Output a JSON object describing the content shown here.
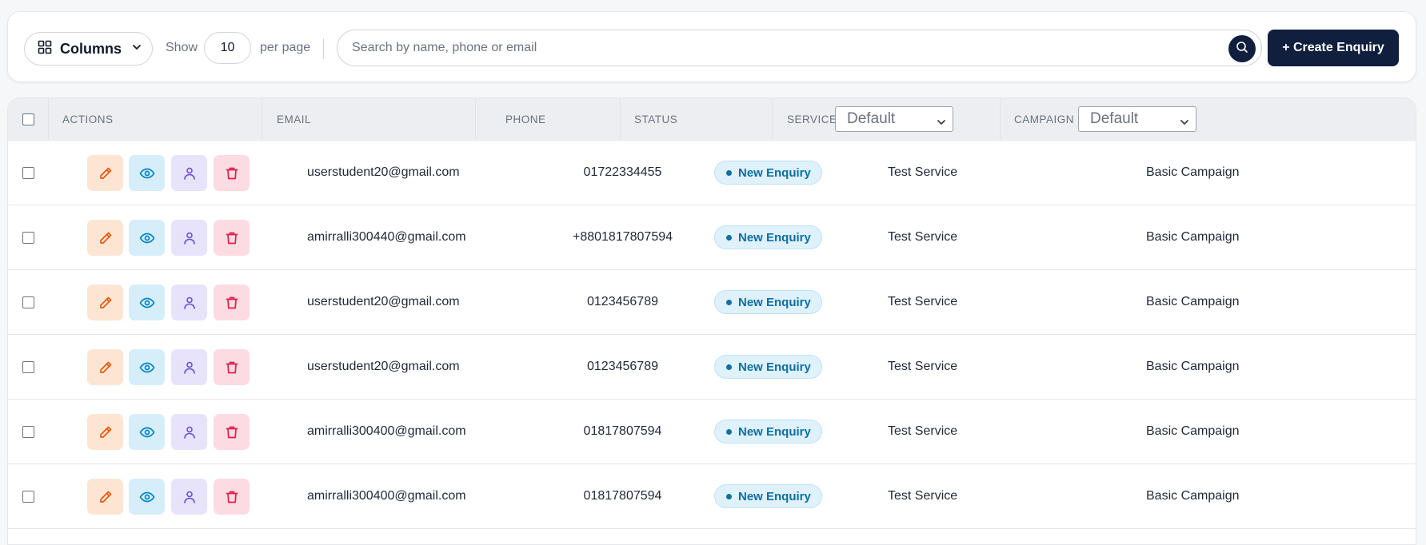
{
  "toolbar": {
    "columns_label": "Columns",
    "show_label": "Show",
    "per_page_value": "10",
    "per_page_label": "per page",
    "search_placeholder": "Search by name, phone or email",
    "create_label": "+ Create Enquiry"
  },
  "table": {
    "headers": {
      "actions": "ACTIONS",
      "email": "EMAIL",
      "phone": "PHONE",
      "status": "STATUS",
      "service": "SERVICE",
      "campaign": "CAMPAIGN"
    },
    "service_filter": "Default",
    "campaign_filter": "Default",
    "rows": [
      {
        "email": "userstudent20@gmail.com",
        "phone": "01722334455",
        "status": "New Enquiry",
        "service": "Test Service",
        "campaign": "Basic Campaign"
      },
      {
        "email": "amirralli300440@gmail.com",
        "phone": "+8801817807594",
        "status": "New Enquiry",
        "service": "Test Service",
        "campaign": "Basic Campaign"
      },
      {
        "email": "userstudent20@gmail.com",
        "phone": "0123456789",
        "status": "New Enquiry",
        "service": "Test Service",
        "campaign": "Basic Campaign"
      },
      {
        "email": "userstudent20@gmail.com",
        "phone": "0123456789",
        "status": "New Enquiry",
        "service": "Test Service",
        "campaign": "Basic Campaign"
      },
      {
        "email": "amirralli300400@gmail.com",
        "phone": "01817807594",
        "status": "New Enquiry",
        "service": "Test Service",
        "campaign": "Basic Campaign"
      },
      {
        "email": "amirralli300400@gmail.com",
        "phone": "01817807594",
        "status": "New Enquiry",
        "service": "Test Service",
        "campaign": "Basic Campaign"
      }
    ]
  },
  "colors": {
    "primary": "#0f1f3d",
    "edit_icon": "#ea580c",
    "view_icon": "#0284c7",
    "user_icon": "#6d4fd6",
    "delete_icon": "#e11d48",
    "status_badge": "#0e6fa3"
  },
  "icons": {
    "columns": "grid-icon",
    "dropdown": "chevron-down-icon",
    "search": "search-icon",
    "edit": "pencil-icon",
    "view": "eye-icon",
    "assign": "user-icon",
    "delete": "trash-icon"
  }
}
